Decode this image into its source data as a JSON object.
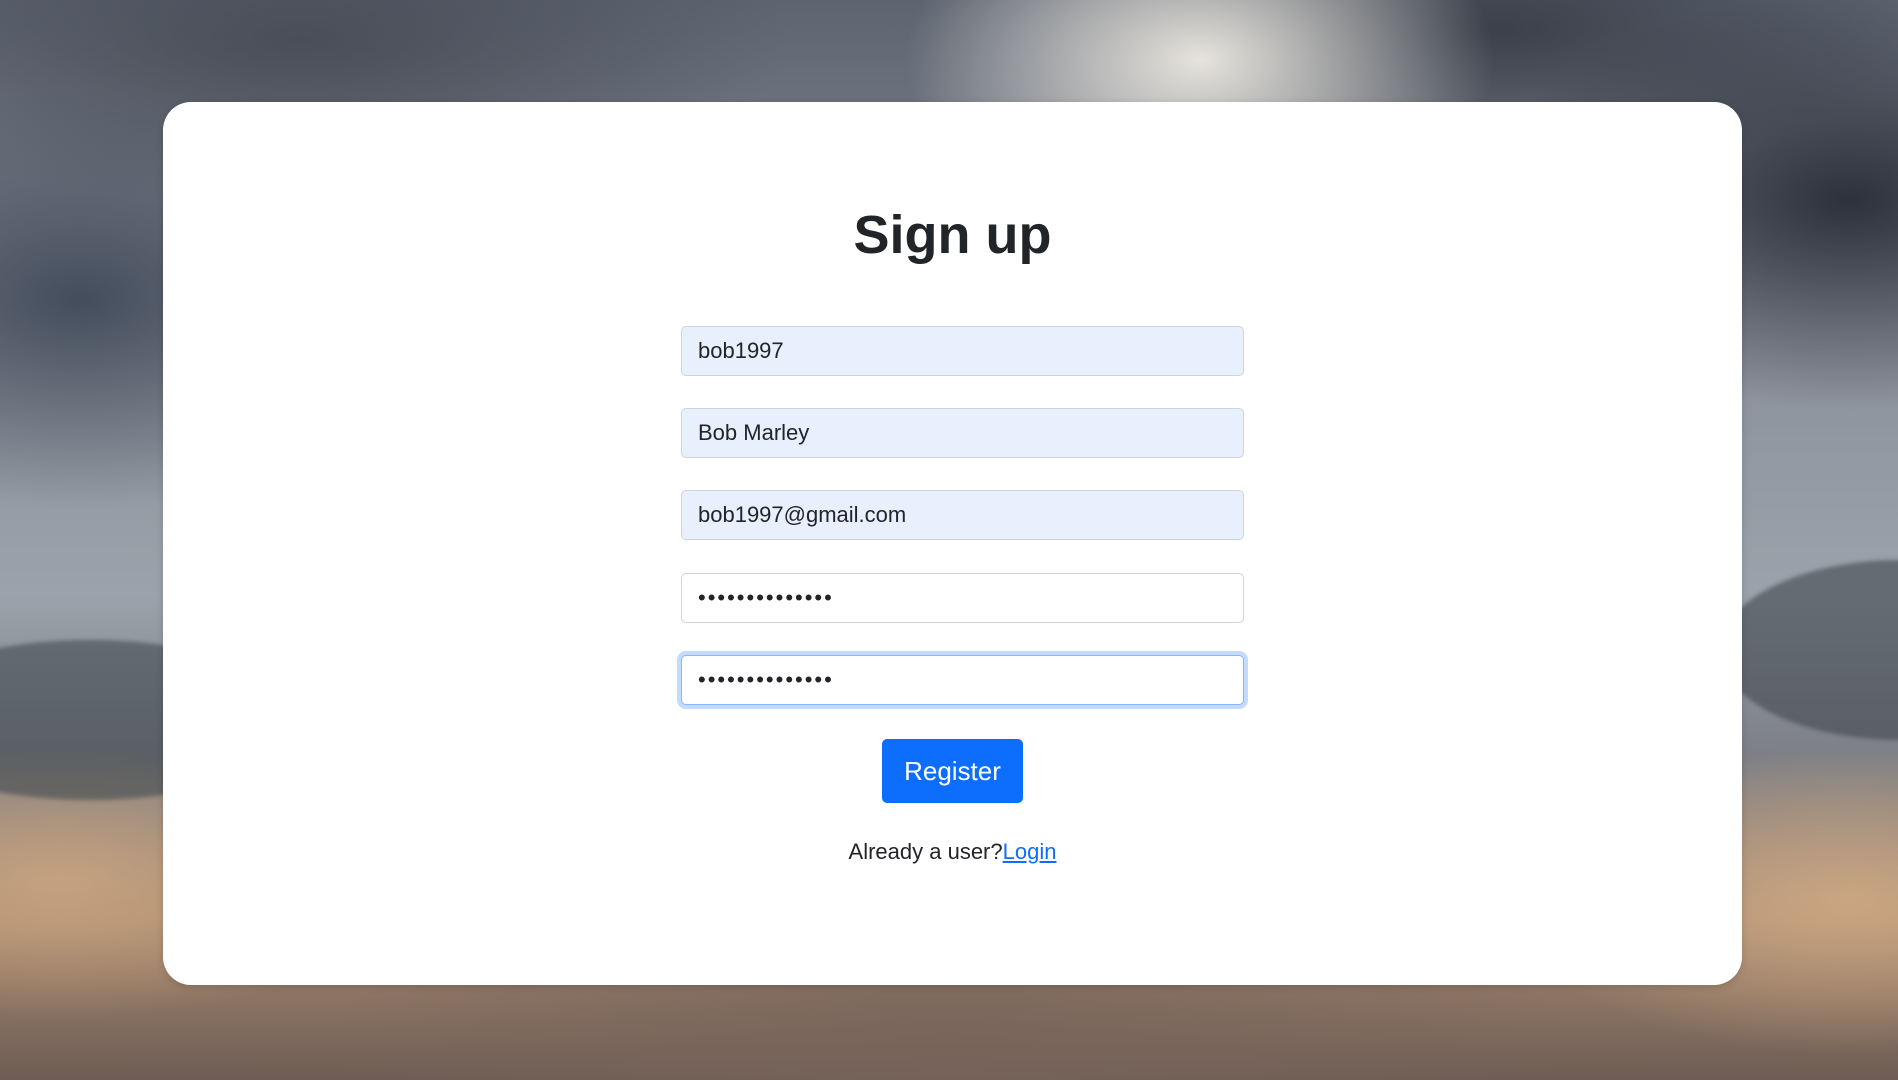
{
  "page": {
    "title": "Sign up"
  },
  "form": {
    "username": {
      "value": "bob1997"
    },
    "fullname": {
      "value": "Bob Marley"
    },
    "email": {
      "value": "bob1997@gmail.com"
    },
    "password": {
      "value": "••••••••••••••"
    },
    "confirm_password": {
      "value": "••••••••••••••"
    },
    "submit_label": "Register"
  },
  "footer": {
    "prompt": "Already a user?",
    "login_link": "Login"
  },
  "colors": {
    "primary": "#0d6efd",
    "autofill_bg": "#e8f0fe",
    "text": "#212529",
    "card_bg": "#ffffff"
  }
}
